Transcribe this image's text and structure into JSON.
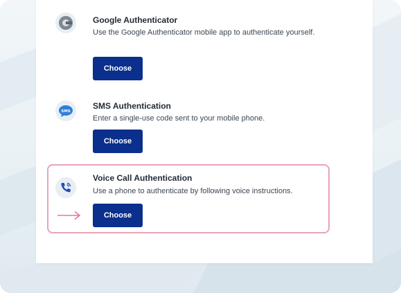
{
  "methods": [
    {
      "title": "Google Authenticator",
      "description": "Use the Google Authenticator mobile app to authenticate yourself.",
      "button": "Choose",
      "icon": "google-authenticator-icon"
    },
    {
      "title": "SMS Authentication",
      "description": "Enter a single-use code sent to your mobile phone.",
      "button": "Choose",
      "icon": "sms-icon"
    },
    {
      "title": "Voice Call Authentication",
      "description": "Use a phone to authenticate by following voice instructions.",
      "button": "Choose",
      "icon": "phone-call-icon"
    }
  ],
  "highlight": {
    "target": "Voice Call Authentication",
    "pointer_icon": "arrow-right-icon"
  },
  "colors": {
    "button_bg": "#0a2f8c",
    "highlight_border": "#e9a4b4",
    "arrow": "#e07a92",
    "sms_icon": "#2f7fd6",
    "phone_icon": "#1f4fb0"
  }
}
